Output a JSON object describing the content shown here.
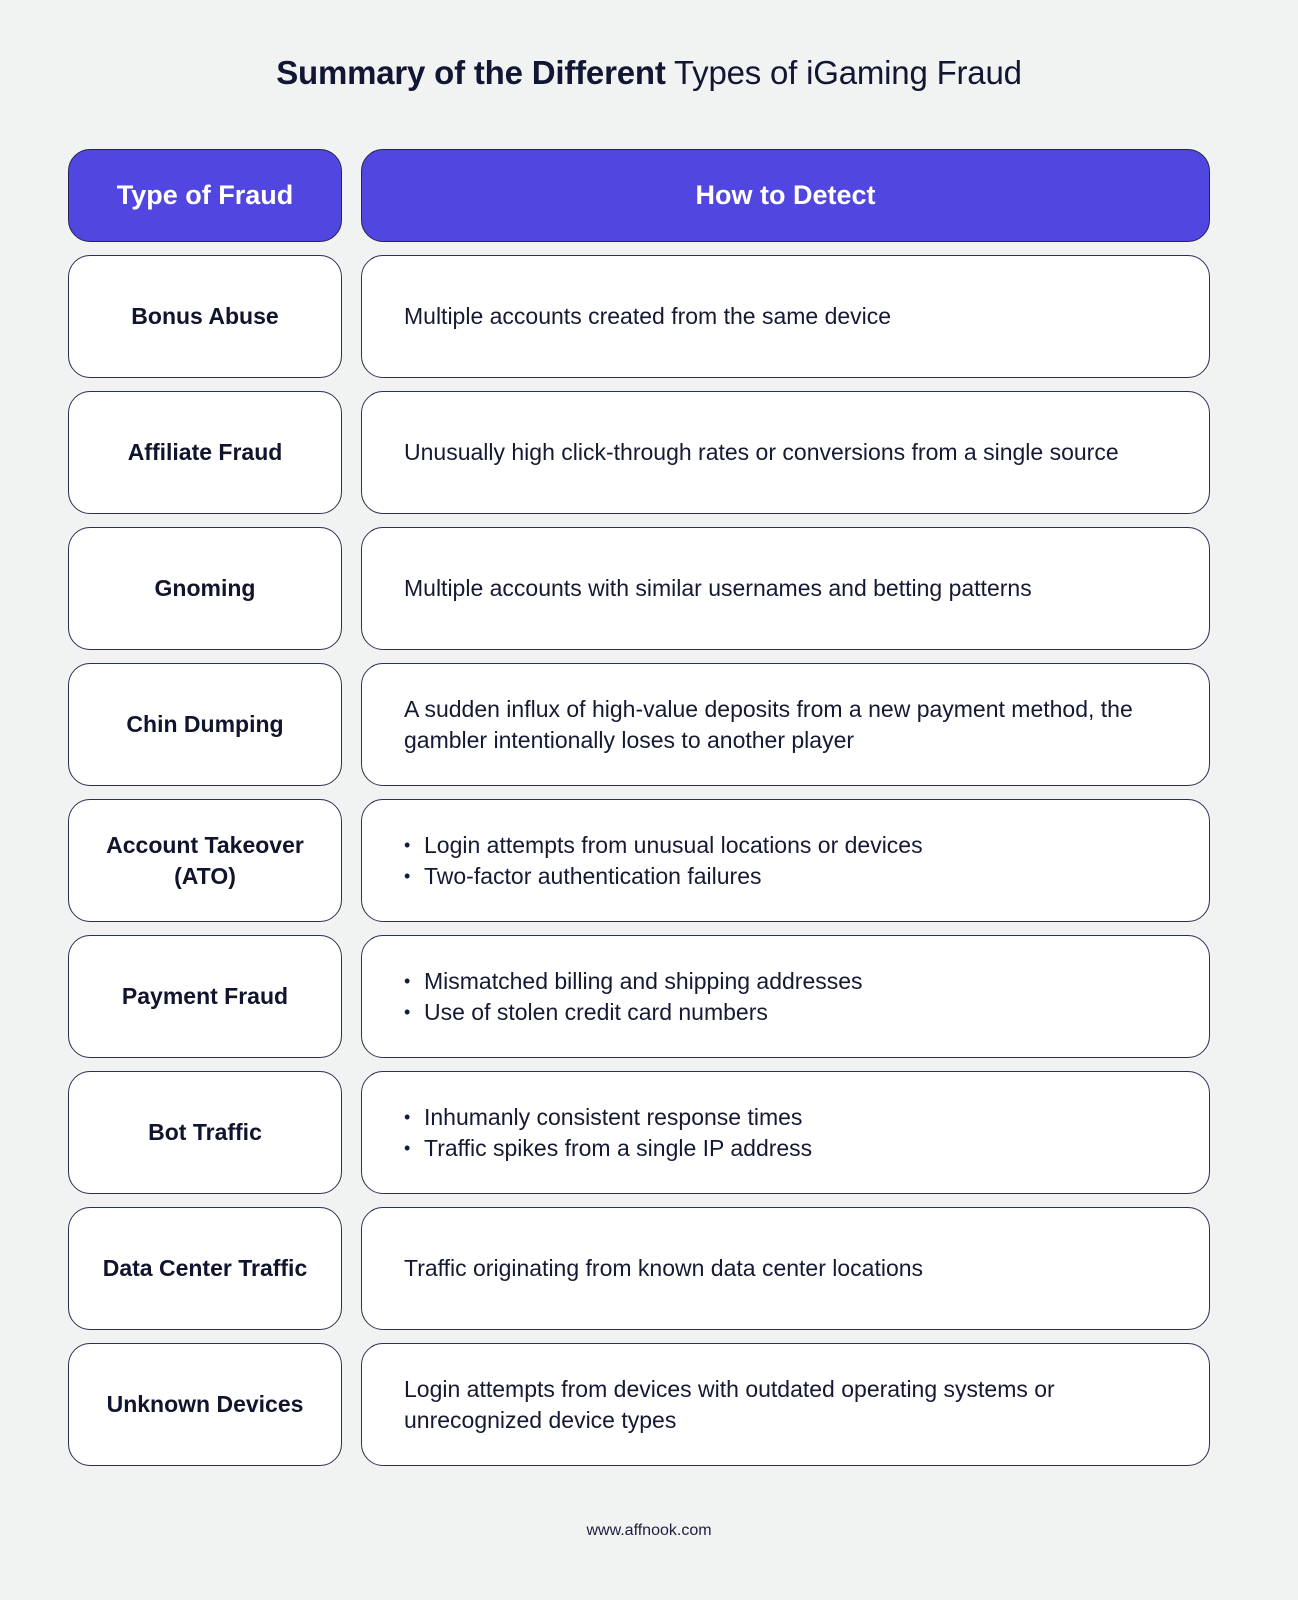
{
  "title": {
    "bold": "Summary of the Different",
    "light": "Types of iGaming Fraud"
  },
  "table": {
    "headers": [
      "Type of Fraud",
      "How to Detect"
    ],
    "rows": [
      {
        "type": "Bonus Abuse",
        "detect": [
          "Multiple accounts created from the same device"
        ],
        "bulleted": false
      },
      {
        "type": "Affiliate Fraud",
        "detect": [
          "Unusually high click-through rates or conversions from a single source"
        ],
        "bulleted": false
      },
      {
        "type": "Gnoming",
        "detect": [
          "Multiple accounts with similar usernames and betting patterns"
        ],
        "bulleted": false
      },
      {
        "type": "Chin Dumping",
        "detect": [
          "A sudden influx of high-value deposits from a new payment method, the gambler intentionally loses to another player"
        ],
        "bulleted": false
      },
      {
        "type": "Account Takeover (ATO)",
        "detect": [
          "Login attempts from unusual locations or devices",
          "Two-factor authentication failures"
        ],
        "bulleted": true
      },
      {
        "type": "Payment Fraud",
        "detect": [
          "Mismatched billing and shipping addresses",
          "Use of stolen credit card numbers"
        ],
        "bulleted": true
      },
      {
        "type": "Bot Traffic",
        "detect": [
          "Inhumanly consistent response times",
          "Traffic spikes from a single IP address"
        ],
        "bulleted": true
      },
      {
        "type": "Data Center Traffic",
        "detect": [
          "Traffic originating from known data center locations"
        ],
        "bulleted": false
      },
      {
        "type": "Unknown Devices",
        "detect": [
          "Login attempts from devices with outdated operating systems or unrecognized device types"
        ],
        "bulleted": false
      }
    ]
  },
  "colors": {
    "header_bg": "#5146e0",
    "page_bg": "#f1f2f2"
  },
  "footer": "www.affnook.com"
}
